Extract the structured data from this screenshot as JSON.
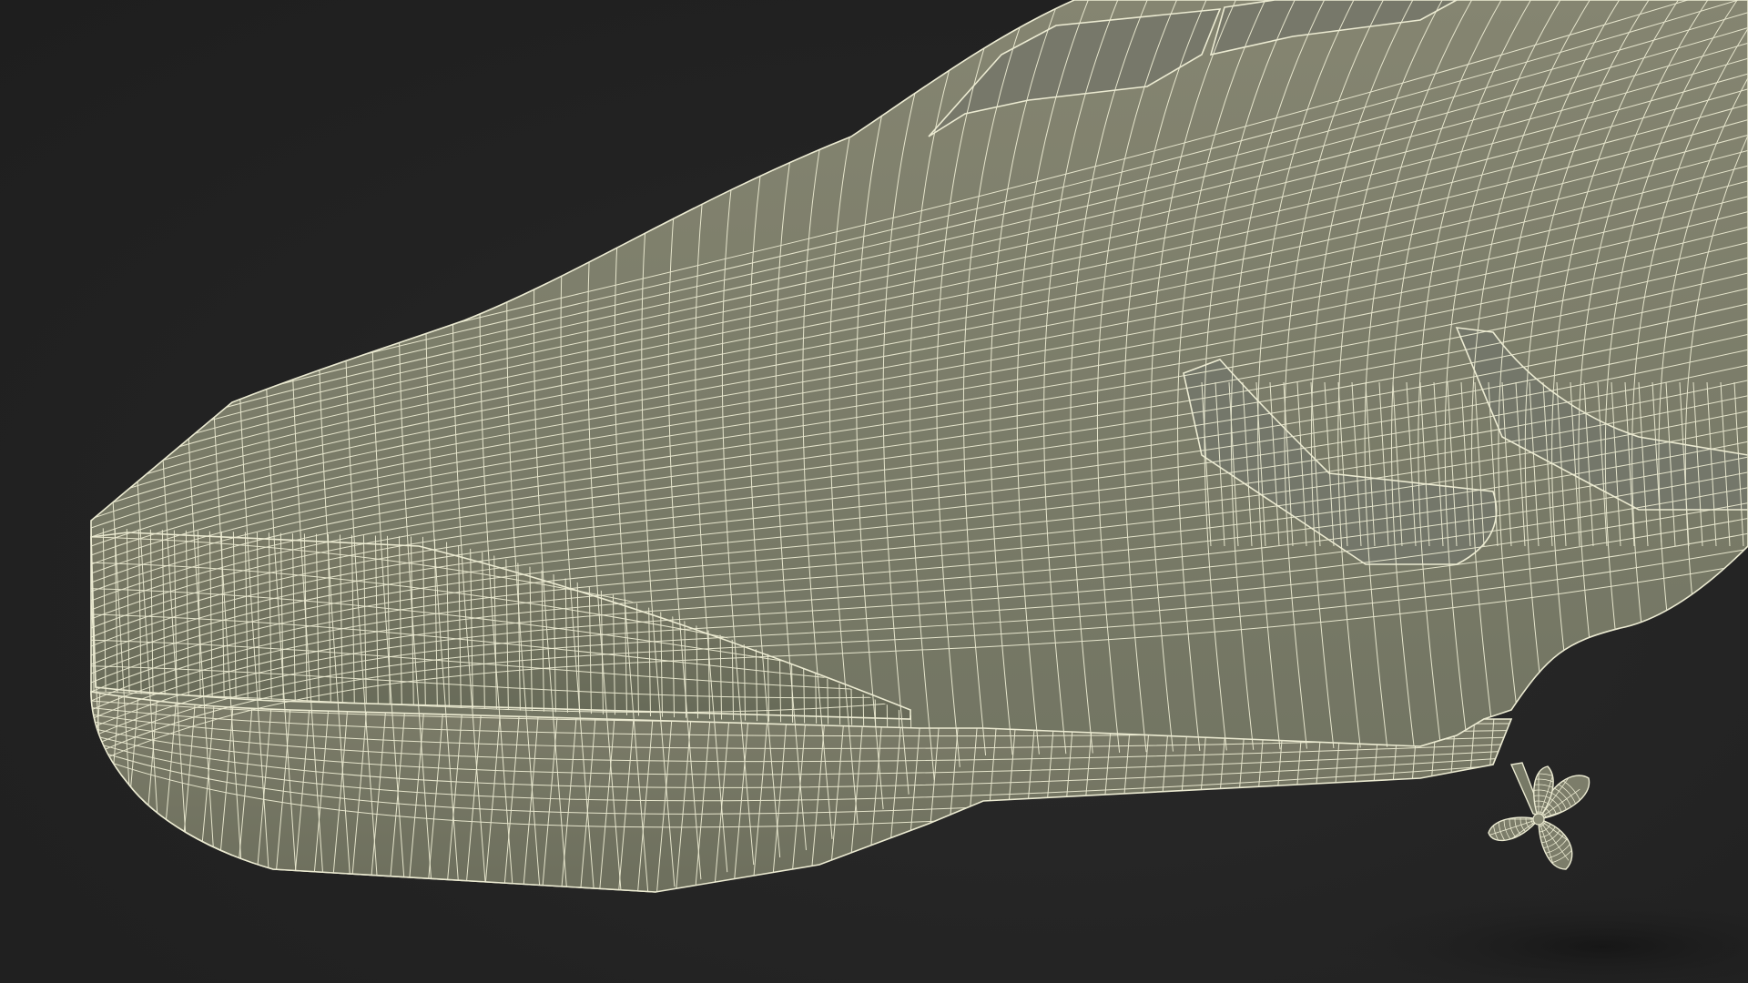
{
  "scene": {
    "subject": "boat-hull-wireframe",
    "background_color": "#232323",
    "surface_color": "#7d7d6a",
    "surface_shadow_color": "#5f6252",
    "wire_color": "#ecebd2",
    "ground_shadow_color": "#1a1a1a"
  }
}
